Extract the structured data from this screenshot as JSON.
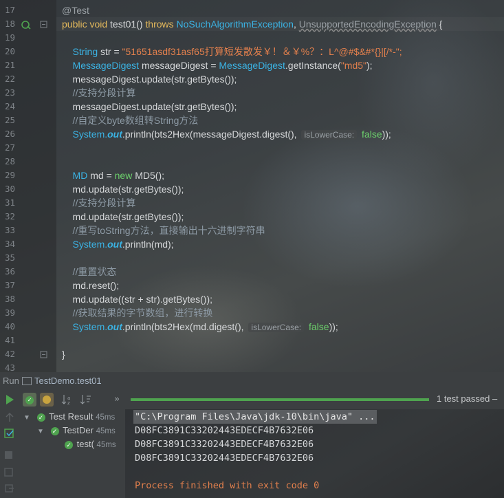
{
  "editor": {
    "lines": [
      {
        "n": "17",
        "segs": [
          {
            "t": "@Test",
            "c": "ann"
          }
        ]
      },
      {
        "n": "18",
        "segs": [
          {
            "t": "public ",
            "c": "kw2"
          },
          {
            "t": "void ",
            "c": "kw2"
          },
          {
            "t": "test01() ",
            "c": "fn"
          },
          {
            "t": "throws ",
            "c": "kw2"
          },
          {
            "t": "NoSuchAlgorithmException",
            "c": "ty"
          },
          {
            "t": ", ",
            "c": "fn"
          },
          {
            "t": "UnsupportedEncodingException",
            "c": "ann wavy"
          },
          {
            "t": " {",
            "c": "fn"
          }
        ]
      },
      {
        "n": "19",
        "segs": []
      },
      {
        "n": "20",
        "segs": [
          {
            "t": "    String ",
            "c": "ty"
          },
          {
            "t": "str = ",
            "c": "fn"
          },
          {
            "t": "\"51651asdf31asf65打算短发散发￥！＆￥%？：L^@#$&#*{}|[/*-\";",
            "c": "str"
          }
        ]
      },
      {
        "n": "21",
        "segs": [
          {
            "t": "    MessageDigest ",
            "c": "ty"
          },
          {
            "t": "messageDigest = ",
            "c": "fn"
          },
          {
            "t": "MessageDigest",
            "c": "ty"
          },
          {
            "t": ".getInstance(",
            "c": "fn"
          },
          {
            "t": "\"md5\"",
            "c": "str"
          },
          {
            "t": ");",
            "c": "fn"
          }
        ]
      },
      {
        "n": "22",
        "segs": [
          {
            "t": "    messageDigest.update(str.getBytes());",
            "c": "fn"
          }
        ]
      },
      {
        "n": "23",
        "segs": [
          {
            "t": "    //支持分段计算",
            "c": "cm"
          }
        ]
      },
      {
        "n": "24",
        "segs": [
          {
            "t": "    messageDigest.update(str.getBytes());",
            "c": "fn"
          }
        ]
      },
      {
        "n": "25",
        "segs": [
          {
            "t": "    //自定义byte数组转String方法",
            "c": "cm"
          }
        ]
      },
      {
        "n": "26",
        "segs": [
          {
            "t": "    System.",
            "c": "ty"
          },
          {
            "t": "out",
            "c": "out"
          },
          {
            "t": ".println(bts2Hex(messageDigest.digest(), ",
            "c": "fn"
          },
          {
            "t": "isLowerCase:",
            "c": "hint"
          },
          {
            "t": " false",
            "c": "bool"
          },
          {
            "t": "));",
            "c": "fn"
          }
        ]
      },
      {
        "n": "27",
        "segs": []
      },
      {
        "n": "28",
        "segs": []
      },
      {
        "n": "29",
        "segs": [
          {
            "t": "    MD ",
            "c": "ty"
          },
          {
            "t": "md = ",
            "c": "fn"
          },
          {
            "t": "new ",
            "c": "bool"
          },
          {
            "t": "MD5();",
            "c": "fn"
          }
        ]
      },
      {
        "n": "30",
        "segs": [
          {
            "t": "    md.update(str.getBytes());",
            "c": "fn"
          }
        ]
      },
      {
        "n": "31",
        "segs": [
          {
            "t": "    //支持分段计算",
            "c": "cm"
          }
        ]
      },
      {
        "n": "32",
        "segs": [
          {
            "t": "    md.update(str.getBytes());",
            "c": "fn"
          }
        ]
      },
      {
        "n": "33",
        "segs": [
          {
            "t": "    //重写toString方法，直接输出十六进制字符串",
            "c": "cm"
          }
        ]
      },
      {
        "n": "34",
        "segs": [
          {
            "t": "    System.",
            "c": "ty"
          },
          {
            "t": "out",
            "c": "out"
          },
          {
            "t": ".println(md);",
            "c": "fn"
          }
        ]
      },
      {
        "n": "35",
        "segs": []
      },
      {
        "n": "36",
        "segs": [
          {
            "t": "    //重置状态",
            "c": "cm"
          }
        ]
      },
      {
        "n": "37",
        "segs": [
          {
            "t": "    md.reset();",
            "c": "fn"
          }
        ]
      },
      {
        "n": "38",
        "segs": [
          {
            "t": "    md.update((str + str).getBytes());",
            "c": "fn"
          }
        ]
      },
      {
        "n": "39",
        "segs": [
          {
            "t": "    //获取结果的字节数组，进行转换",
            "c": "cm"
          }
        ]
      },
      {
        "n": "40",
        "segs": [
          {
            "t": "    System.",
            "c": "ty"
          },
          {
            "t": "out",
            "c": "out"
          },
          {
            "t": ".println(bts2Hex(md.digest(), ",
            "c": "fn"
          },
          {
            "t": "isLowerCase:",
            "c": "hint"
          },
          {
            "t": " false",
            "c": "bool"
          },
          {
            "t": "));",
            "c": "fn"
          }
        ]
      },
      {
        "n": "41",
        "segs": []
      },
      {
        "n": "42",
        "segs": [
          {
            "t": "}",
            "c": "fn"
          }
        ]
      },
      {
        "n": "43",
        "segs": []
      }
    ]
  },
  "run_panel": {
    "run_label": "Run",
    "config_name": "TestDemo.test01",
    "status_text": "1 test passed –",
    "tree": [
      {
        "label": "Test Result",
        "time": "45ms",
        "indent": 0
      },
      {
        "label": "TestDer",
        "time": "45ms",
        "indent": 1
      },
      {
        "label": "test(",
        "time": "45ms",
        "indent": 2
      }
    ],
    "console": {
      "command": "\"C:\\Program Files\\Java\\jdk-10\\bin\\java\" ...",
      "outputs": [
        "D08FC3891C33202443EDECF4B7632E06",
        "D08FC3891C33202443EDECF4B7632E06",
        "D08FC3891C33202443EDECF4B7632E06"
      ],
      "exit_message": "Process finished with exit code 0"
    }
  },
  "colors": {
    "progress": "#4fa34f",
    "exit_message": "#e3804d",
    "accent": "#3bb3e4"
  }
}
